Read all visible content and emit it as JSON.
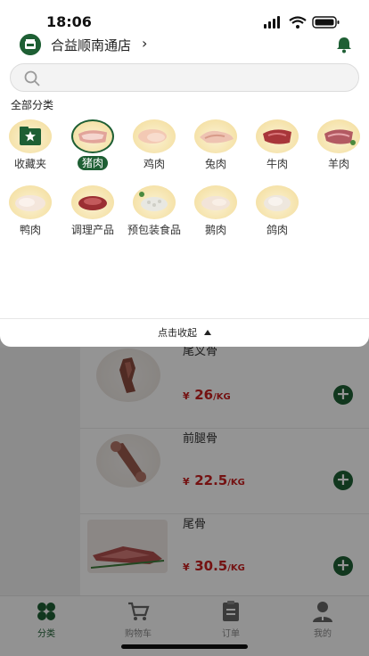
{
  "status_bar": {
    "time": "18:06"
  },
  "header": {
    "store_name": "合益顺南通店",
    "chevron": "›"
  },
  "search": {
    "placeholder": ""
  },
  "categories_panel": {
    "title": "全部分类",
    "selected": "猪肉",
    "items": [
      {
        "label": "收藏夹",
        "icon": "favorites-folder-icon"
      },
      {
        "label": "猪肉",
        "icon": "pork-icon"
      },
      {
        "label": "鸡肉",
        "icon": "chicken-icon"
      },
      {
        "label": "兔肉",
        "icon": "rabbit-icon"
      },
      {
        "label": "牛肉",
        "icon": "beef-icon"
      },
      {
        "label": "羊肉",
        "icon": "mutton-icon"
      },
      {
        "label": "鸭肉",
        "icon": "duck-icon"
      },
      {
        "label": "调理产品",
        "icon": "prepared-products-icon"
      },
      {
        "label": "预包装食品",
        "icon": "packaged-food-icon"
      },
      {
        "label": "鹅肉",
        "icon": "goose-icon"
      },
      {
        "label": "鸽肉",
        "icon": "pigeon-icon"
      }
    ],
    "collapse_label": "点击收起"
  },
  "products": [
    {
      "name": "尾叉骨",
      "currency": "¥",
      "price": "26",
      "unit": "/KG"
    },
    {
      "name": "前腿骨",
      "currency": "¥",
      "price": "22.5",
      "unit": "/KG"
    },
    {
      "name": "尾骨",
      "currency": "¥",
      "price": "30.5",
      "unit": "/KG"
    }
  ],
  "tab_bar": {
    "tabs": [
      {
        "label": "分类",
        "icon": "category-icon",
        "active": true
      },
      {
        "label": "购物车",
        "icon": "cart-icon",
        "active": false
      },
      {
        "label": "订单",
        "icon": "order-icon",
        "active": false
      },
      {
        "label": "我的",
        "icon": "profile-icon",
        "active": false
      }
    ]
  },
  "colors": {
    "brand_green": "#1e5f34",
    "price_red": "#c9201f"
  }
}
